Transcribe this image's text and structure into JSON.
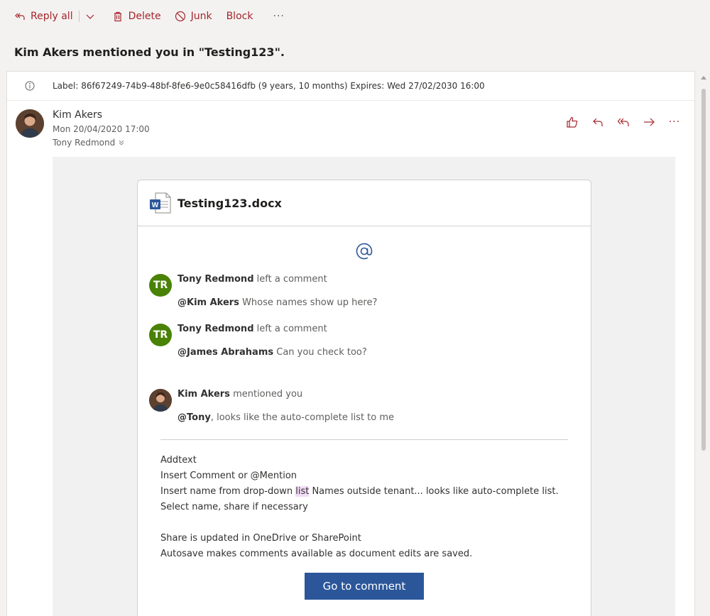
{
  "toolbar": {
    "reply_all": "Reply all",
    "delete": "Delete",
    "junk": "Junk",
    "block": "Block",
    "more": "···"
  },
  "subject": "Kim Akers mentioned you in \"Testing123\".",
  "label_bar": {
    "text": "Label: 86f67249-74b9-48bf-8fe6-9e0c58416dfb (9 years, 10 months) Expires: Wed 27/02/2030 16:00"
  },
  "message": {
    "sender": "Kim Akers",
    "date": "Mon 20/04/2020 17:00",
    "to": "Tony Redmond",
    "more": "···"
  },
  "document": {
    "title": "Testing123.docx",
    "comments": [
      {
        "initials": "TR",
        "author": "Tony Redmond",
        "action": " left a comment",
        "mention": "@Kim Akers",
        "text": " Whose names show up here?"
      },
      {
        "initials": "TR",
        "author": "Tony Redmond",
        "action": " left a comment",
        "mention": "@James Abrahams",
        "text": " Can you check too?"
      },
      {
        "author": "Kim Akers",
        "action": " mentioned you",
        "mention": "@Tony",
        "text": ", looks like the auto-complete list to me"
      }
    ],
    "body_lines": {
      "l1": "Addtext",
      "l2": "Insert Comment or @Mention",
      "l3a": "Insert name from drop-down ",
      "l3_hl": "list",
      "l3b": " Names outside tenant... looks like auto-complete list.",
      "l4": "Select name, share if necessary",
      "l5": "Share is updated in OneDrive or SharePoint",
      "l6": "Autosave makes comments available as document edits are saved."
    },
    "cta": "Go to comment"
  },
  "colors": {
    "accent": "#a4262c",
    "word_blue": "#2b579a",
    "avatar_green": "#498205"
  }
}
